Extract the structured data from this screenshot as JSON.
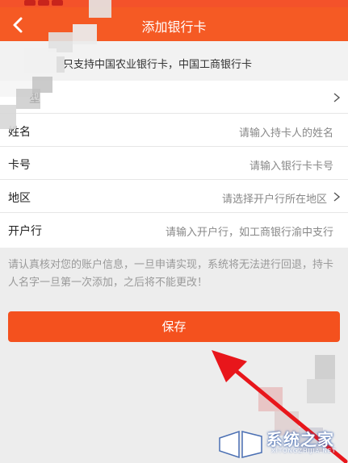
{
  "header": {
    "title": "添加银行卡",
    "back_icon": "chevron-left-icon"
  },
  "notice": {
    "text": "只支持中国农业银行卡，中国工商银行卡"
  },
  "form": {
    "rows": [
      {
        "label": "型",
        "value": "",
        "has_chevron": true
      },
      {
        "label": "姓名",
        "value": "请输入持卡人的姓名",
        "has_chevron": false
      },
      {
        "label": "卡号",
        "value": "请输入银行卡卡号",
        "has_chevron": false
      },
      {
        "label": "地区",
        "value": "请选择开户行所在地区",
        "has_chevron": true
      },
      {
        "label": "开户行",
        "value": "请输入开户行，如工商银行渝中支行",
        "has_chevron": false
      }
    ]
  },
  "hint": {
    "text": "请认真核对您的账户信息，一旦申请实现，系统将无法进行回退，持卡人名字一旦第一次添加，之后将不能更改！"
  },
  "save_button": {
    "label": "保存"
  },
  "watermark": {
    "text": "系统之家",
    "sub": "XITONGZHIJIA.NET"
  },
  "colors": {
    "accent": "#f55a24",
    "button": "#f4511e",
    "annotation_arrow": "#e8161b"
  }
}
